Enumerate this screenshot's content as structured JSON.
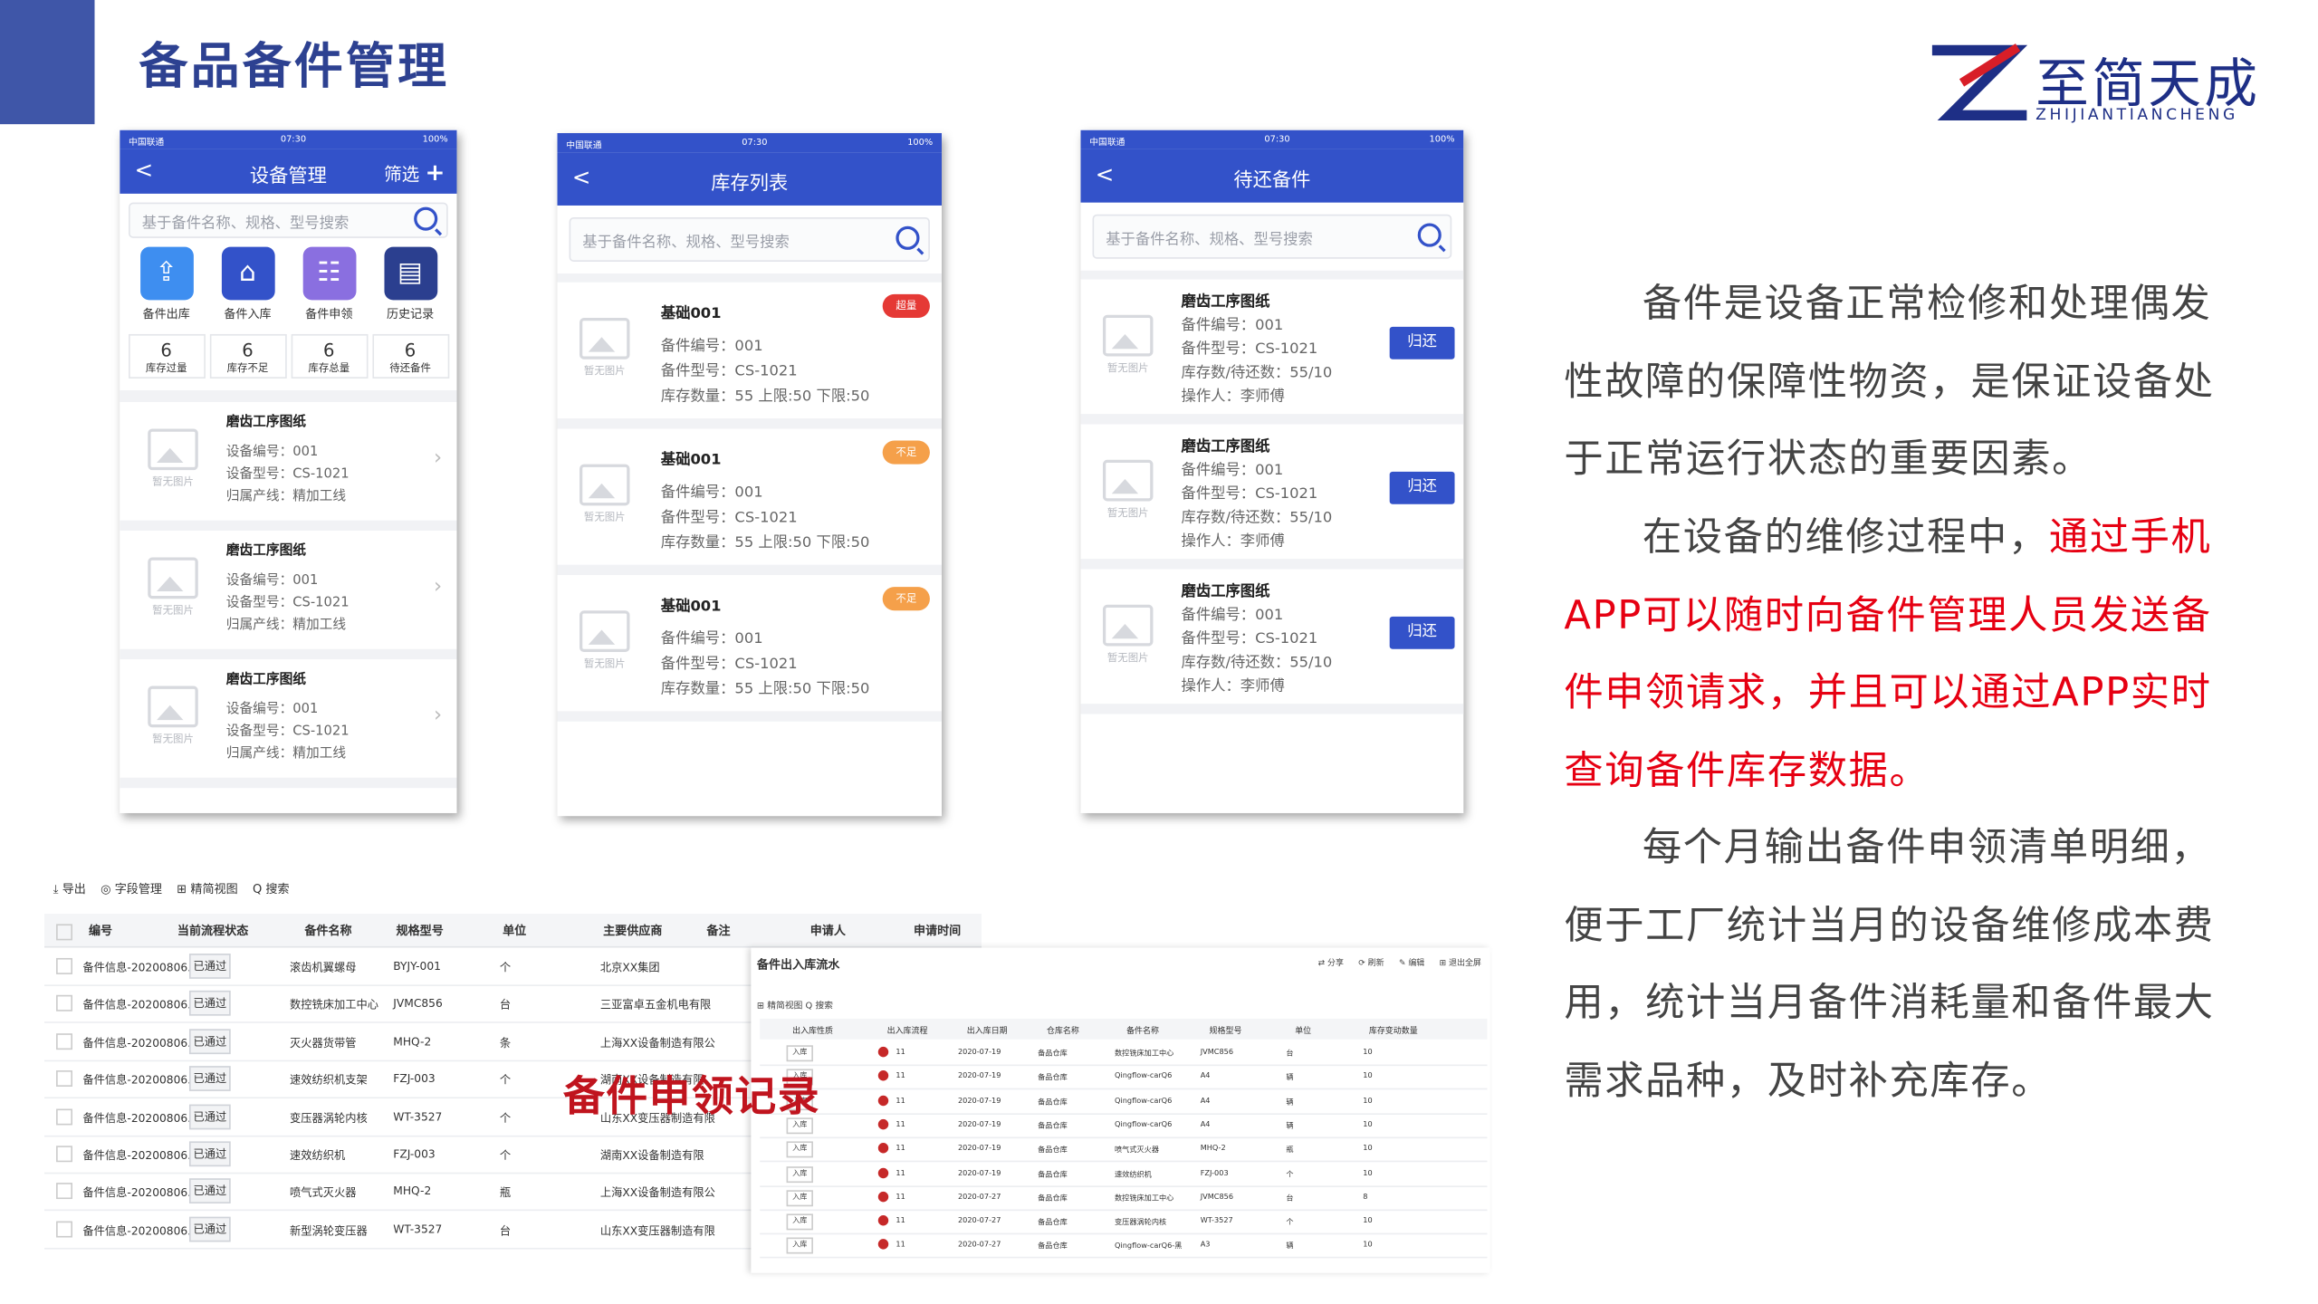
{
  "header": {
    "title": "备品备件管理",
    "logo_cn": "至简天成",
    "logo_en": "ZHIJIANTIANCHENG"
  },
  "phone1": {
    "status": {
      "carrier": "中国联通",
      "time": "07:30",
      "battery": "100%"
    },
    "nav": {
      "back": "<",
      "title": "设备管理",
      "filter": "筛选",
      "plus": "+"
    },
    "search_placeholder": "基于备件名称、规格、型号搜索",
    "tiles": [
      {
        "label": "备件出库",
        "color": "#3e8ef0",
        "glyph": "⇪"
      },
      {
        "label": "备件入库",
        "color": "#3352c9",
        "glyph": "⌂"
      },
      {
        "label": "备件申领",
        "color": "#8a6fe0",
        "glyph": "☷"
      },
      {
        "label": "历史记录",
        "color": "#2b3f8f",
        "glyph": "▤"
      }
    ],
    "stats": [
      {
        "num": "6",
        "label": "库存过量"
      },
      {
        "num": "6",
        "label": "库存不足"
      },
      {
        "num": "6",
        "label": "库存总量"
      },
      {
        "num": "6",
        "label": "待还备件"
      }
    ],
    "no_image": "暂无图片",
    "items": [
      {
        "name": "磨齿工序图纸",
        "l1": "设备编号：001",
        "l2": "设备型号：CS-1021",
        "l3": "归属产线：精加工线"
      },
      {
        "name": "磨齿工序图纸",
        "l1": "设备编号：001",
        "l2": "设备型号：CS-1021",
        "l3": "归属产线：精加工线"
      },
      {
        "name": "磨齿工序图纸",
        "l1": "设备编号：001",
        "l2": "设备型号：CS-1021",
        "l3": "归属产线：精加工线"
      }
    ]
  },
  "phone2": {
    "status": {
      "carrier": "中国联通",
      "time": "07:30",
      "battery": "100%"
    },
    "nav": {
      "back": "<",
      "title": "库存列表"
    },
    "search_placeholder": "基于备件名称、规格、型号搜索",
    "no_image": "暂无图片",
    "items": [
      {
        "name": "基础001",
        "badge": "超量",
        "badge_color": "#e53935",
        "l1": "备件编号：001",
        "l2": "备件型号：CS-1021",
        "l3": "库存数量：55   上限:50   下限:50"
      },
      {
        "name": "基础001",
        "badge": "不足",
        "badge_color": "#f5a04a",
        "l1": "备件编号：001",
        "l2": "备件型号：CS-1021",
        "l3": "库存数量：55   上限:50   下限:50"
      },
      {
        "name": "基础001",
        "badge": "不足",
        "badge_color": "#f5a04a",
        "l1": "备件编号：001",
        "l2": "备件型号：CS-1021",
        "l3": "库存数量：55   上限:50   下限:50"
      }
    ]
  },
  "phone3": {
    "status": {
      "carrier": "中国联通",
      "time": "07:30",
      "battery": "100%"
    },
    "nav": {
      "back": "<",
      "title": "待还备件"
    },
    "search_placeholder": "基于备件名称、规格、型号搜索",
    "no_image": "暂无图片",
    "items": [
      {
        "name": "磨齿工序图纸",
        "l1": "备件编号：001",
        "l2": "备件型号：CS-1021",
        "l3": "库存数/待还数：55/10",
        "l4": "操作人：李师傅",
        "btn": "归还"
      },
      {
        "name": "磨齿工序图纸",
        "l1": "备件编号：001",
        "l2": "备件型号：CS-1021",
        "l3": "库存数/待还数：55/10",
        "l4": "操作人：李师傅",
        "btn": "归还"
      },
      {
        "name": "磨齿工序图纸",
        "l1": "备件编号：001",
        "l2": "备件型号：CS-1021",
        "l3": "库存数/待还数：55/10",
        "l4": "操作人：李师傅",
        "btn": "归还"
      }
    ]
  },
  "text": {
    "p1": "备件是设备正常检修和处理偶发性故障的保障性物资，是保证设备处于正常运行状态的重要因素。",
    "p2a": "在设备的维修过程中，",
    "p2b": "通过手机APP可以随时向备件管理人员发送备件申领请求，并且可以通过APP实时查询备件库存数据。",
    "p3": "每个月输出备件申领清单明细，便于工厂统计当月的设备维修成本费用，统计当月备件消耗量和备件最大需求品种，及时补充库存。"
  },
  "table1": {
    "toolbar": [
      "⤓ 导出",
      "◎ 字段管理",
      "⊞ 精简视图",
      "Q 搜索"
    ],
    "headers": [
      "编号",
      "当前流程状态",
      "备件名称",
      "规格型号",
      "单位",
      "主要供应商",
      "备注",
      "申请人",
      "申请时间"
    ],
    "rows": [
      [
        "备件信息-20200806...",
        "已通过",
        "滚齿机翼螺母",
        "BYJY-001",
        "个",
        "北京XX集团"
      ],
      [
        "备件信息-20200806...",
        "已通过",
        "数控铣床加工中心",
        "JVMC856",
        "台",
        "三亚富卓五金机电有限"
      ],
      [
        "备件信息-20200806...",
        "已通过",
        "灭火器货带管",
        "MHQ-2",
        "条",
        "上海XX设备制造有限公"
      ],
      [
        "备件信息-20200806...",
        "已通过",
        "速效纺织机支架",
        "FZJ-003",
        "个",
        "湖南XX设备制造有限"
      ],
      [
        "备件信息-20200806...",
        "已通过",
        "变压器涡轮内核",
        "WT-3527",
        "个",
        "山东XX变压器制造有限"
      ],
      [
        "备件信息-20200806...",
        "已通过",
        "速效纺织机",
        "FZJ-003",
        "个",
        "湖南XX设备制造有限"
      ],
      [
        "备件信息-20200806...",
        "已通过",
        "喷气式灭火器",
        "MHQ-2",
        "瓶",
        "上海XX设备制造有限公"
      ],
      [
        "备件信息-20200806...",
        "已通过",
        "新型涡轮变压器",
        "WT-3527",
        "台",
        "山东XX变压器制造有限"
      ]
    ]
  },
  "overlay_label": "备件申领记录",
  "table2": {
    "title": "备件出入库流水",
    "tools": "⊞ 精简视图  Q 搜索",
    "right_tools": [
      "⇄ 分享",
      "⟳ 刷新",
      "✎ 编辑",
      "⊞ 退出全屏"
    ],
    "headers": [
      "出入库性质",
      "出入库流程",
      "出入库日期",
      "仓库名称",
      "备件名称",
      "规格型号",
      "单位",
      "库存变动数量"
    ],
    "rows": [
      [
        "入库",
        "11",
        "2020-07-19",
        "备品仓库",
        "数控铣床加工中心",
        "JVMC856",
        "台",
        "10"
      ],
      [
        "入库",
        "11",
        "2020-07-19",
        "备品仓库",
        "Qingflow-carQ6",
        "A4",
        "辆",
        "10"
      ],
      [
        "入库",
        "11",
        "2020-07-19",
        "备品仓库",
        "Qingflow-carQ6",
        "A4",
        "辆",
        "10"
      ],
      [
        "入库",
        "11",
        "2020-07-19",
        "备品仓库",
        "Qingflow-carQ6",
        "A4",
        "辆",
        "10"
      ],
      [
        "入库",
        "11",
        "2020-07-19",
        "备品仓库",
        "喷气式灭火器",
        "MHQ-2",
        "瓶",
        "10"
      ],
      [
        "入库",
        "11",
        "2020-07-19",
        "备品仓库",
        "速效纺织机",
        "FZJ-003",
        "个",
        "10"
      ],
      [
        "入库",
        "11",
        "2020-07-27",
        "备品仓库",
        "数控铣床加工中心",
        "JVMC856",
        "台",
        "8"
      ],
      [
        "入库",
        "11",
        "2020-07-27",
        "备品仓库",
        "变压器涡轮内核",
        "WT-3527",
        "个",
        "10"
      ],
      [
        "入库",
        "11",
        "2020-07-27",
        "备品仓库",
        "Qingflow-carQ6-黑",
        "A3",
        "辆",
        "10"
      ]
    ]
  }
}
